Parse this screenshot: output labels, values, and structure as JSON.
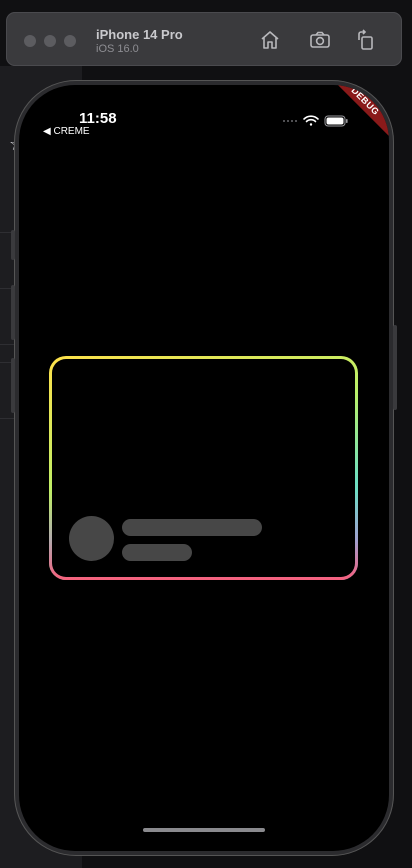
{
  "simulator": {
    "device_name": "iPhone 14 Pro",
    "os_version": "iOS 16.0",
    "buttons": [
      "home-icon",
      "screenshot-icon",
      "rotate-icon"
    ]
  },
  "status_bar": {
    "time": "11:58",
    "back_label": "◀ CREME"
  },
  "debug_banner": "DEBUG",
  "card": {
    "border_gradient": [
      "#ffe14a",
      "#b8f06a",
      "#6fe0c0",
      "#6ecbe8",
      "#ff5a78"
    ],
    "placeholder_color": "#474747"
  }
}
